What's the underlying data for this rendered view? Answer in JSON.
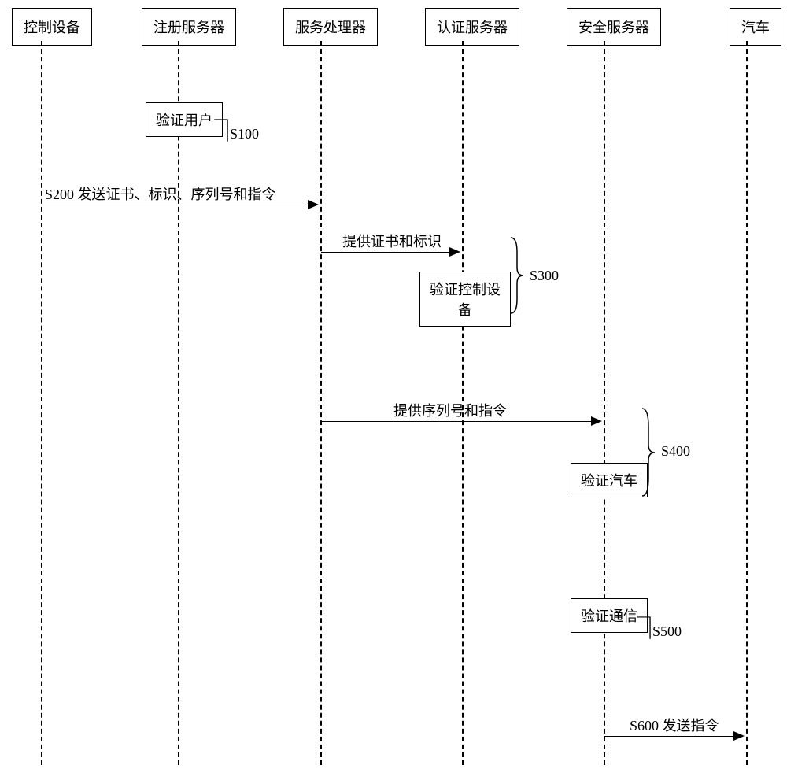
{
  "participants": {
    "p1": "控制设备",
    "p2": "注册服务器",
    "p3": "服务处理器",
    "p4": "认证服务器",
    "p5": "安全服务器",
    "p6": "汽车"
  },
  "actions": {
    "verify_user": "验证用户",
    "verify_device": "验证控制设\n备",
    "verify_car": "验证汽车",
    "verify_comm": "验证通信"
  },
  "messages": {
    "m200": "S200 发送证书、标识、序列号和指令",
    "m_cert_id": "提供证书和标识",
    "m_seq_cmd": "提供序列号和指令",
    "m600": "S600 发送指令"
  },
  "steps": {
    "s100": "S100",
    "s300": "S300",
    "s400": "S400",
    "s500": "S500"
  }
}
